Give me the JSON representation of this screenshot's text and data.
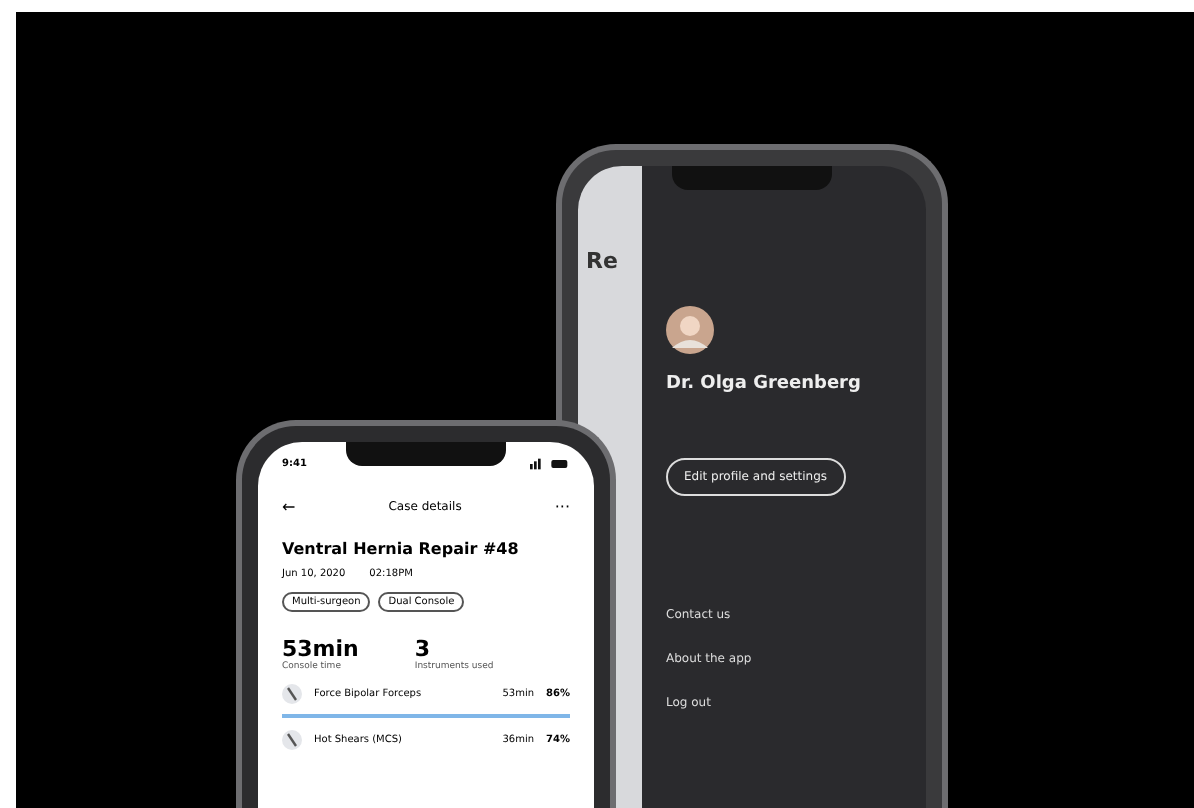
{
  "back_phone": {
    "underlying_title": "Re",
    "profile_name": "Dr. Olga Greenberg",
    "edit_button": "Edit profile and settings",
    "menu": [
      "Contact us",
      "About the app",
      "Log out"
    ]
  },
  "front_phone": {
    "status_time": "9:41",
    "header": {
      "back": "←",
      "title": "Case details",
      "more": "···"
    },
    "case_title": "Ventral Hernia Repair #48",
    "date": "Jun 10, 2020",
    "time": "02:18PM",
    "tags": [
      "Multi-surgeon",
      "Dual Console"
    ],
    "stats": [
      {
        "value": "53min",
        "label": "Console time"
      },
      {
        "value": "3",
        "label": "Instruments used"
      }
    ],
    "rows": [
      {
        "name": "Force Bipolar Forceps",
        "duration": "53min",
        "percent": "86%",
        "selected": true
      },
      {
        "name": "Hot Shears (MCS)",
        "duration": "36min",
        "percent": "74%",
        "selected": false
      }
    ]
  }
}
